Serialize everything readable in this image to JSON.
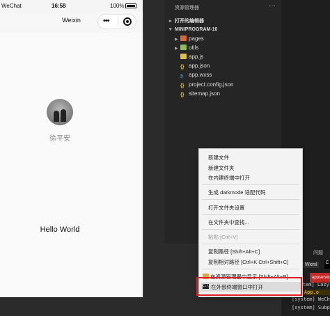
{
  "simulator": {
    "status": {
      "carrier": "WeChat",
      "time": "16:58",
      "battery": "100%"
    },
    "nav_title": "Weixin",
    "capsule_more": "•••",
    "nickname": "徐平安",
    "hello": "Hello World"
  },
  "explorer": {
    "title": "资源管理器",
    "more": "···",
    "open_editors": "打开的编辑器",
    "project": "MINIPROGRAM-10",
    "items": [
      {
        "label": "pages",
        "icon": "folder-pages-icon"
      },
      {
        "label": "utils",
        "icon": "folder-utils-icon"
      },
      {
        "label": "app.js",
        "icon": "js-file-icon"
      },
      {
        "label": "app.json",
        "icon": "json-file-icon"
      },
      {
        "label": "app.wxss",
        "icon": "wxss-file-icon"
      },
      {
        "label": "project.config.json",
        "icon": "json-file-icon"
      },
      {
        "label": "sitemap.json",
        "icon": "json-file-icon"
      }
    ]
  },
  "console": {
    "tab_wen": "问题",
    "tab_wxml": "Wxml",
    "tab_c": "C",
    "appservice": "appservice",
    "logs": [
      "[system] Lazy",
      "em] App.o",
      "[system] WeCha",
      "[system] Subpa"
    ]
  },
  "context_menu": {
    "new_file": "新建文件",
    "new_folder": "新建文件夹",
    "open_in_builtin_terminal": "在内建终端中打开",
    "gen_darkmode": "生成 darkmode 适配代码",
    "open_folder_settings": "打开文件夹设置",
    "find_in_folder": "在文件夹中查找...",
    "paste": "粘贴 [Ctrl+V]",
    "copy_path": "复制路径 [Shift+Alt+C]",
    "copy_relative_path": "复制相对路径 [Ctrl+K Ctrl+Shift+C]",
    "reveal_in_explorer": "在资源管理器中显示 [Shift+Alt+R]",
    "open_in_external_terminal": "在外部终端窗口中打开"
  }
}
